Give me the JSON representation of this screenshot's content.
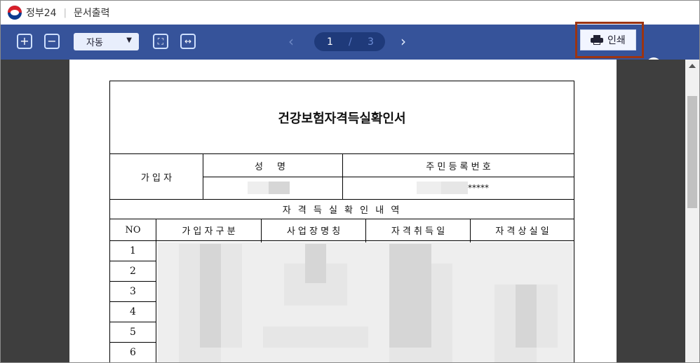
{
  "window": {
    "brand": "정부24",
    "separator": "|",
    "title": "문서출력"
  },
  "toolbar": {
    "zoom_in_label": "+",
    "zoom_out_label": "−",
    "zoom_value": "자동",
    "fit_page_label": "⛶",
    "fit_width_label": "↔",
    "prev_label": "‹",
    "next_label": "›",
    "current_page": "1",
    "page_separator": "/",
    "total_pages": "3",
    "print_label": "인쇄",
    "help_label": "?"
  },
  "document": {
    "title": "건강보험자격득실확인서",
    "subscriber_label": "가 입 자",
    "name_header": "성 명",
    "rrn_header": "주 민 등 록 번 호",
    "rrn_masked": "*****",
    "history_header": "자 격 득 실 확 인 내 역",
    "columns": [
      "NO",
      "가 입 자 구 분",
      "사 업 장 명 칭",
      "자 격 취 득 일",
      "자 격 상 실 일"
    ],
    "rows": [
      "1",
      "2",
      "3",
      "4",
      "5",
      "6"
    ]
  }
}
